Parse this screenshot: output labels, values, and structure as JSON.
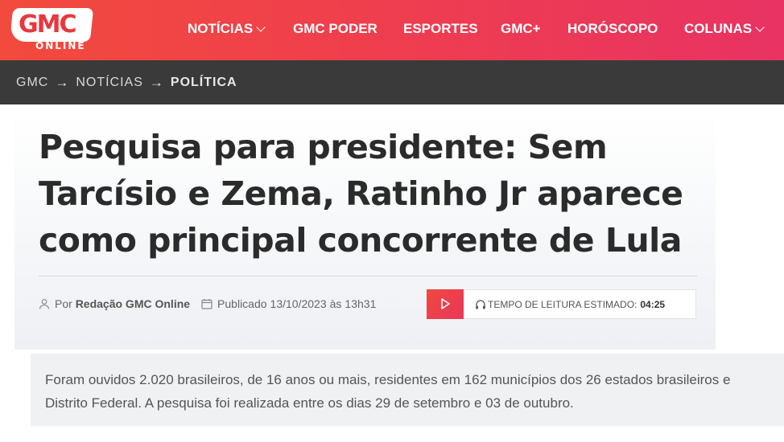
{
  "header": {
    "logo": {
      "main": "GMC",
      "sub": "ONLINE"
    },
    "nav": [
      {
        "label": "NOTÍCIAS",
        "has_dropdown": true
      },
      {
        "label": "GMC PODER",
        "has_dropdown": false
      },
      {
        "label": "ESPORTES",
        "has_dropdown": false
      },
      {
        "label": "GMC+",
        "has_dropdown": false
      },
      {
        "label": "HORÓSCOPO",
        "has_dropdown": false
      },
      {
        "label": "COLUNAS",
        "has_dropdown": true
      }
    ],
    "colors": {
      "gradient_start": "#f24a3d",
      "gradient_end": "#e83363"
    }
  },
  "breadcrumb": {
    "items": [
      "GMC",
      "NOTÍCIAS",
      "POLÍTICA"
    ],
    "separator_icon": "arrow-right-icon"
  },
  "article": {
    "title": "Pesquisa para presidente: Sem Tarcísio e Zema, Ratinho Jr aparece como principal concorrente de Lula",
    "author_prefix": "Por",
    "author": "Redação GMC Online",
    "published_label": "Publicado",
    "published_date": "13/10/2023",
    "published_connector": "às",
    "published_time": "13h31",
    "reading_label": "TEMPO DE LEITURA ESTIMADO:",
    "reading_time": "04:25",
    "icons": {
      "author": "user-icon",
      "date": "calendar-icon",
      "play": "play-icon",
      "audio": "headphones-icon"
    },
    "summary": "Foram ouvidos 2.020 brasileiros, de 16 anos ou mais, residentes em 162 municípios dos 26 estados brasileiros e Distrito Federal. A pesquisa foi realizada entre os dias 29 de setembro e 03 de outubro."
  }
}
